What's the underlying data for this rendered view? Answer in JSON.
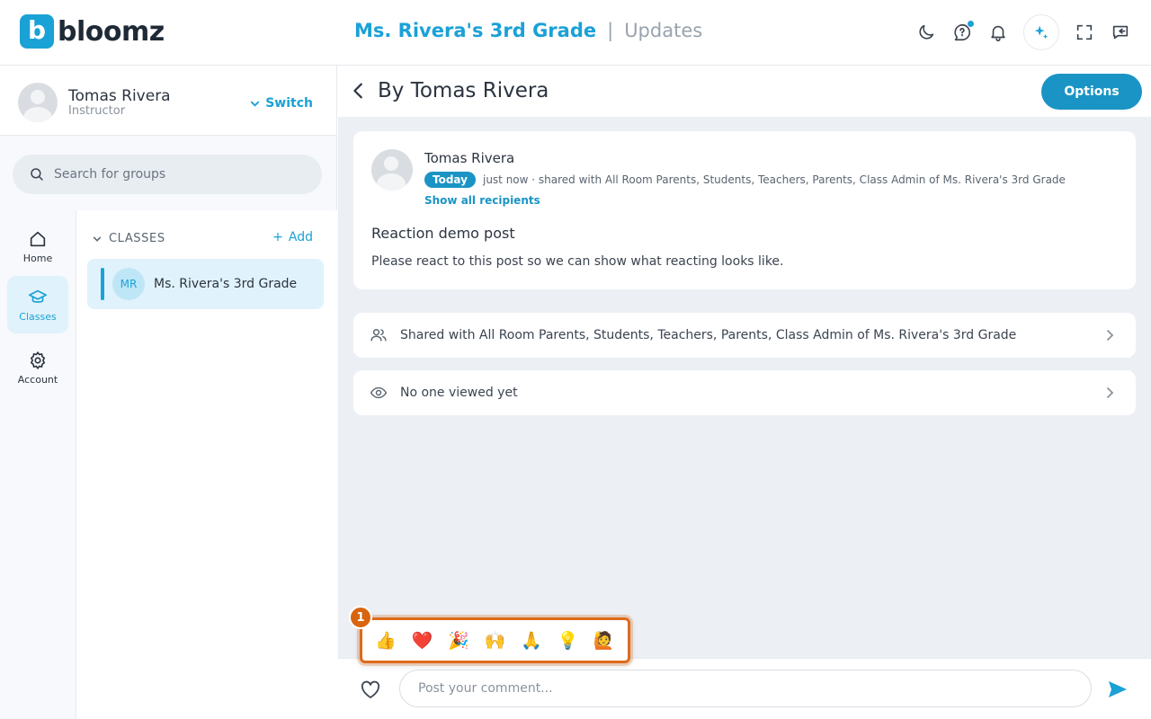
{
  "app": {
    "logo_text": "bloomz",
    "logo_letter": "b"
  },
  "header": {
    "class_name": "Ms. Rivera's 3rd Grade",
    "separator": "|",
    "section": "Updates"
  },
  "icons": {
    "theme": "moon-icon",
    "help": "help-chat-icon",
    "notifications": "bell-icon",
    "ai": "sparkle-icon",
    "fullscreen": "fullscreen-icon",
    "collapse": "collapse-panel-icon"
  },
  "profile": {
    "name": "Tomas Rivera",
    "role": "Instructor",
    "switch_label": "Switch"
  },
  "search": {
    "placeholder": "Search for groups"
  },
  "rail": [
    {
      "label": "Home",
      "icon": "home-icon"
    },
    {
      "label": "Classes",
      "icon": "graduation-cap-icon"
    },
    {
      "label": "Account",
      "icon": "gear-icon"
    }
  ],
  "classes": {
    "heading": "CLASSES",
    "add_label": "Add",
    "items": [
      {
        "initials": "MR",
        "name": "Ms. Rivera's 3rd Grade"
      }
    ]
  },
  "post_view": {
    "title": "By Tomas Rivera",
    "options_label": "Options",
    "post": {
      "author": "Tomas Rivera",
      "badge": "Today",
      "meta": "just now · shared with All Room Parents, Students, Teachers, Parents, Class Admin of Ms. Rivera's 3rd Grade",
      "show_all": "Show all recipients",
      "title": "Reaction demo post",
      "body": "Please react to this post so we can show what reacting looks like."
    },
    "shared_with": "Shared with All Room Parents, Students, Teachers, Parents, Class Admin of Ms. Rivera's 3rd Grade",
    "views": "No one viewed yet"
  },
  "reactions": {
    "step": "1",
    "items": [
      "👍",
      "❤️",
      "🎉",
      "🙌",
      "🙏",
      "💡",
      "🙋"
    ]
  },
  "comment": {
    "placeholder": "Post your comment..."
  },
  "colors": {
    "brand": "#1aa1d6",
    "highlight": "#dd6b1a"
  }
}
